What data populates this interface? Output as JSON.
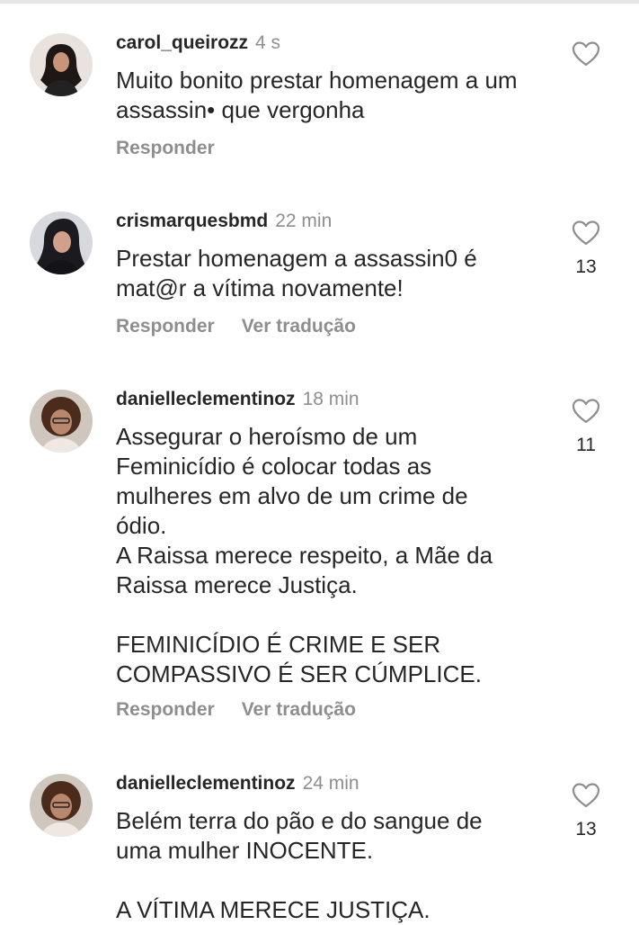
{
  "comments": [
    {
      "username": "carol_queirozz",
      "time": "4 s",
      "text": "Muito bonito prestar homenagem a um\nassassin• que vergonha",
      "reply": "Responder",
      "translate": "",
      "likes": "",
      "avatar_icon": "profile-photo"
    },
    {
      "username": "crismarquesbmd",
      "time": "22 min",
      "text": "Prestar homenagem a assassin0 é\nmat@r a vítima novamente!",
      "reply": "Responder",
      "translate": "Ver tradução",
      "likes": "13",
      "avatar_icon": "profile-photo"
    },
    {
      "username": "danielleclementinoz",
      "time": "18 min",
      "text": "Assegurar o heroísmo de um\nFeminicídio é colocar todas as\nmulheres em alvo de um crime de\nódio.\nA Raissa merece respeito, a Mãe da\nRaissa merece Justiça.\n\nFEMINICÍDIO É CRIME E SER\nCOMPASSIVO É SER CÚMPLICE.",
      "reply": "Responder",
      "translate": "Ver tradução",
      "likes": "11",
      "avatar_icon": "profile-photo"
    },
    {
      "username": "danielleclementinoz",
      "time": "24 min",
      "text": "Belém terra do pão e do sangue de\numa mulher INOCENTE.\n\nA VÍTIMA MERECE JUSTIÇA.",
      "reply": "",
      "translate": "",
      "likes": "13",
      "avatar_icon": "profile-photo"
    }
  ],
  "colors": {
    "text": "#262626",
    "secondary": "#8e8e8e",
    "divider": "#e6e6e6"
  }
}
